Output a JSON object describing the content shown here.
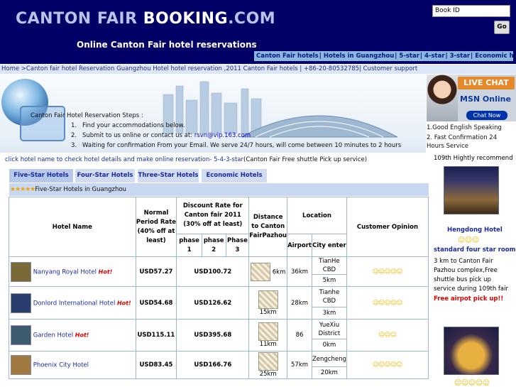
{
  "header": {
    "logo_part1": "CANTON FAIR ",
    "logo_part2": "BOOKING",
    "logo_part3": ".COM",
    "tagline": "Online Canton Fair hotel reservations",
    "bookid_placeholder": "Book ID",
    "go_label": "Go",
    "nav": [
      "Canton Fair hotels",
      "Hotels in Guangzhou",
      "5-star",
      "4-star",
      "3-star",
      "Economic hotels"
    ],
    "colors": {
      "header_bg": "#000066",
      "nav_bg": "#8ab6e0"
    }
  },
  "breadcrumb": "Home >Canton fair hotel Reservation Guangzhou Hotel hotel reservation ,2011 Canton Fair hotels | +86-20-80532785| Customer support",
  "banner": {
    "steps_title": "Canton Fair Hotel Reservation Steps :",
    "steps": [
      {
        "num": "1.",
        "text": "Find your accommodations below."
      },
      {
        "num": "2.",
        "text": "Submit to us online or contact us at: ",
        "email": "rsvn@vip.163.com"
      },
      {
        "num": "3.",
        "text": "Waiting for confirmation From your Email. We serve 24/7 hours, will come between 10 minutes to 2 hours"
      }
    ]
  },
  "livechat": {
    "title": "LIVE CHAT",
    "msn": "MSN Online",
    "button": "Chat Now",
    "notes": [
      "1.Good English Speaking",
      "2. Fast Confirmation 24 Hours Service"
    ]
  },
  "intro": {
    "link": "click hotel name to check hotel details and make online reservation- 5-4-3-star",
    "rest": "(Canton Fair Free shuttle Pick up service)"
  },
  "tabs": [
    "Five-Star Hotels",
    "Four-Star Hotels",
    "Three-Star Hotels",
    "Economic Hotels"
  ],
  "active_tab": "Five-Star Hotels",
  "section": {
    "stars": "★★★★★",
    "label": "Five-Star Hotels in Guangzhou"
  },
  "table": {
    "headers": {
      "name": "Hotel Name",
      "normal": "Normal Period Rate (40% off at least)",
      "discount": "Discount Rate for Canton fair 2011 (30% off at least)",
      "phase1": "phase 1",
      "phase2": "phase 2",
      "phase3": "Phase 3",
      "distance": "Distance to Canton FairPazhou",
      "location": "Location",
      "airport": "Airport",
      "city": "City enter",
      "opinion": "Customer Opinion"
    },
    "rows": [
      {
        "name": "Nanyang Royal Hotel",
        "hot": "Hot!",
        "normal": "USD57.27",
        "discount": "USD100.72",
        "distance": "6km",
        "airport": "36km",
        "district": "TianHe CBD",
        "city": "5km",
        "opinion": "☺☺☺☺☺",
        "thumb_color": "#7a6a3a"
      },
      {
        "name": "Donlord International Hotel",
        "hot": "Hot!",
        "normal": "USD54.68",
        "discount": "USD126.62",
        "distance": "15km",
        "airport": "28km",
        "district": "Tianhe CBD",
        "city": "3km",
        "opinion": "☺☺☺☺☺",
        "thumb_color": "#2a3e6e"
      },
      {
        "name": "Garden Hotel",
        "hot": "Hot!",
        "normal": "USD115.11",
        "discount": "USD395.68",
        "distance": "11km",
        "airport": "86",
        "district": "YueXiu District",
        "city": "0km",
        "opinion": "☺☺☺",
        "thumb_color": "#3e5a6e"
      },
      {
        "name": "Phoenix City Hotel",
        "hot": "",
        "normal": "USD83.45",
        "discount": "USD166.76",
        "distance": "25km",
        "airport": "57km",
        "district": "Zengcheng",
        "city": "20km",
        "opinion": "☺☺☺☺☺",
        "thumb_color": "#a07a40"
      }
    ]
  },
  "promo": {
    "heading": "109th Hightly recommend",
    "hotel_name": "Hengdong Hotel",
    "stars": "☺☺☺",
    "standard": "standard four star rooms",
    "desc": "3 km to Canton Fair Pazhou complex,Free shuttle bus pick up service during 109th fair",
    "airport_note": "Free airpot pick up!!",
    "bottom_stars": "☺☺☺☺☺"
  }
}
